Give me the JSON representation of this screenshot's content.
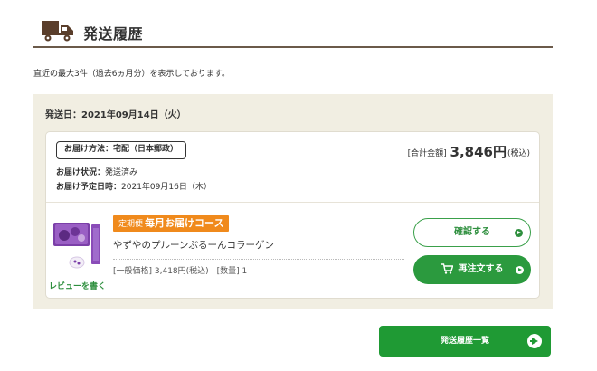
{
  "header": {
    "title": "発送履歴",
    "icon": "truck-icon"
  },
  "intro_text": "直近の最大3件（過去6ヵ月分）を表示しております。",
  "shipment": {
    "date_label": "発送日：",
    "date_value": "2021年09月14日（火）",
    "method": "お届け方法：宅配（日本郵政）",
    "status_label": "お届け状況：",
    "status_value": "発送済み",
    "eta_label": "お届け予定日時：",
    "eta_value": "2021年09月16日（木）",
    "total_prefix": "[合計金額]",
    "total_amount": "3,846円",
    "total_suffix": "(税込)"
  },
  "product": {
    "badge_small": "定期便",
    "badge_big": "毎月お届けコース",
    "name": "やずやのプルーンぷるーんコラーゲン",
    "details": "[一般価格] 3,418円(税込)　[数量] 1",
    "review_link": "レビューを書く"
  },
  "buttons": {
    "confirm": "確認する",
    "reorder": "再注文する",
    "history": "発送履歴一覧"
  },
  "colors": {
    "accent_green": "#2b9a3e",
    "badge_orange": "#f08a1c",
    "panel_beige": "#f1eee2"
  }
}
